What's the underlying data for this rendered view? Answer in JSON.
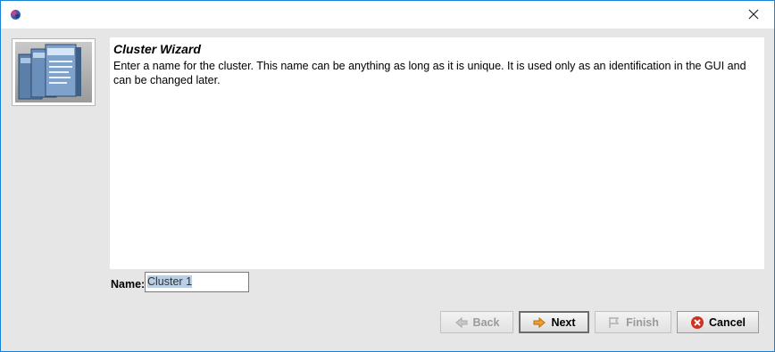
{
  "window": {
    "title": ""
  },
  "wizard": {
    "title": "Cluster Wizard",
    "description": "Enter a name for the cluster. This name can be anything as long as it is unique. It is used only as an identification in the GUI and can be changed later."
  },
  "name_field": {
    "label": "Name:",
    "value": "Cluster 1"
  },
  "buttons": {
    "back": {
      "label": "Back",
      "icon": "back-arrow-icon",
      "enabled": false
    },
    "next": {
      "label": "Next",
      "icon": "next-arrow-icon",
      "enabled": true
    },
    "finish": {
      "label": "Finish",
      "icon": "finish-icon",
      "enabled": false
    },
    "cancel": {
      "label": "Cancel",
      "icon": "cancel-icon",
      "enabled": true
    }
  },
  "colors": {
    "accent_border": "#1883d7",
    "next_arrow": "#f0a030",
    "cancel_red": "#d03020"
  }
}
